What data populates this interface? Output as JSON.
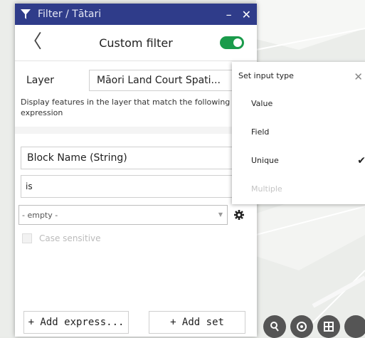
{
  "window": {
    "title": "Filter / Tātari",
    "minimize": "–",
    "close": "✕"
  },
  "header": {
    "back": "〈",
    "title": "Custom filter",
    "toggle_on": true
  },
  "layer": {
    "label": "Layer",
    "value": "Māori Land Court Spati..."
  },
  "description": "Display features in the layer that match the following expression",
  "expression": {
    "field": "Block Name (String)",
    "operator": "is",
    "value_placeholder": "- empty -",
    "case_sensitive_label": "Case sensitive"
  },
  "buttons": {
    "add_expression": "+ Add express...",
    "add_set": "+ Add set"
  },
  "popup": {
    "title": "Set input type",
    "close": "✕",
    "items": [
      {
        "label": "Value",
        "checked": false,
        "disabled": false
      },
      {
        "label": "Field",
        "checked": false,
        "disabled": false
      },
      {
        "label": "Unique",
        "checked": true,
        "disabled": false
      },
      {
        "label": "Multiple",
        "checked": false,
        "disabled": true
      }
    ],
    "check_mark": "✔"
  },
  "colors": {
    "titlebar": "#2f3c8a",
    "toggle": "#1a9b4b",
    "map_tools": "#555555"
  }
}
